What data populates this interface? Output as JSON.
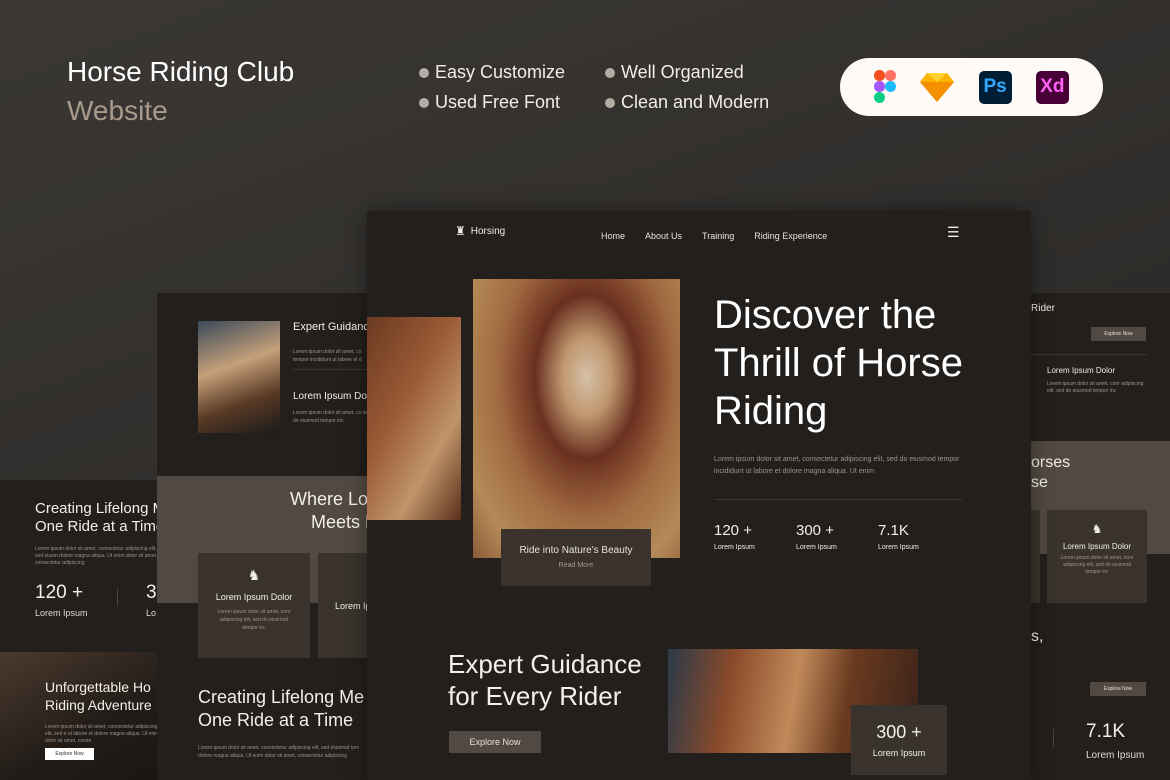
{
  "header": {
    "title": "Horse Riding Club",
    "subtitle": "Website",
    "features": [
      "Easy Customize",
      "Well Organized",
      "Used Free Font",
      "Clean and Modern"
    ],
    "tools": [
      {
        "name": "figma-icon"
      },
      {
        "name": "sketch-icon"
      },
      {
        "name": "photoshop-icon",
        "label": "Ps",
        "color": "#31a8ff"
      },
      {
        "name": "xd-icon",
        "label": "Xd",
        "color": "#ff61f6"
      }
    ]
  },
  "main": {
    "logo": "Horsing",
    "nav": [
      "Home",
      "About Us",
      "Training",
      "Riding Experience"
    ],
    "hero_title": "Discover the Thrill of Horse Riding",
    "hero_text": "Lorem ipsum dolor sit amet, consectetur adipiscing elit, sed do eiusmod tempor incididunt ut labore et dolore magna aliqua. Ut enim",
    "stats": [
      {
        "value": "120 +",
        "label": "Lorem Ipsum"
      },
      {
        "value": "300 +",
        "label": "Lorem Ipsum"
      },
      {
        "value": "7.1K",
        "label": "Lorem Ipsum"
      }
    ],
    "caption": "Ride into Nature's Beauty",
    "read_more": "Read More",
    "guide_title": "Expert Guidance for Every Rider",
    "explore": "Explore Now",
    "guide_stat": {
      "value": "300 +",
      "label": "Lorem Ipsum"
    }
  },
  "left2": {
    "expert": "Expert Guidanc",
    "expert_text": "Lorem ipsum dolor sit amet, co tempor incididunt ut labore et d",
    "lorem_title": "Lorem Ipsum Dolo",
    "lorem_text": "Lorem ipsum dolor sit amet, co sed do eiusmod tempor inc",
    "where": "Where Lov",
    "meets": "Meets E",
    "card_title": "Lorem Ipsum Dolor",
    "card_text": "Lorem ipsum dolor sit amet, conr adipiscing elit, sed do eiusmod tempor inc",
    "card2_title": "Lorem Ip",
    "creating": "Creating Lifelong Me",
    "one_ride": "One Ride at a Time",
    "creating_text": "Lorem ipsum dolor sit amet, consectetur adipiscing elit, sed eiusmod tem dolore magna aliqua. Ut enim dolor sit amet, consectetur adipiscing"
  },
  "left1": {
    "creating": "Creating Lifelong M",
    "one_ride": "One Ride at a Time",
    "text": "Lorem ipsum dolor sit amet, consectetur adipiscing elit, sed eiusm dolore magna aliqua. Ut enim dolor sit amet, consectetur adipiscing",
    "stat_value": "120 +",
    "stat_label": "Lorem Ipsum",
    "stat2_value": "3",
    "stat2_label": "Lo",
    "adv1": "Unforgettable Ho",
    "adv2": "Riding Adventure",
    "adv_text": "Lorem ipsum dolor sit amet, consectetur adipiscing elit, sed e ut labore et dolore magna aliqua. Ut enim dolor sit amet, conse",
    "explore": "Explore Now"
  },
  "right": {
    "rider": "Rider",
    "explore": "Explore Now",
    "lorem_title": "Lorem Ipsum Dolor",
    "lorem_text": "Lorem ipsum dolor sit amet, conr adipiscing elit, sed do eiusmod tempor inc",
    "horses": "orses",
    "se": "se",
    "card_title": "Lorem Ipsum Dolor",
    "card_text": "Lorem ipsum dolor sit amet, conr adipiscing elit, sed do eiusmod tempor inc",
    "s": "s,",
    "explore2": "Explore Now",
    "stat_value": "7.1K",
    "stat_label": "Lorem Ipsum"
  }
}
